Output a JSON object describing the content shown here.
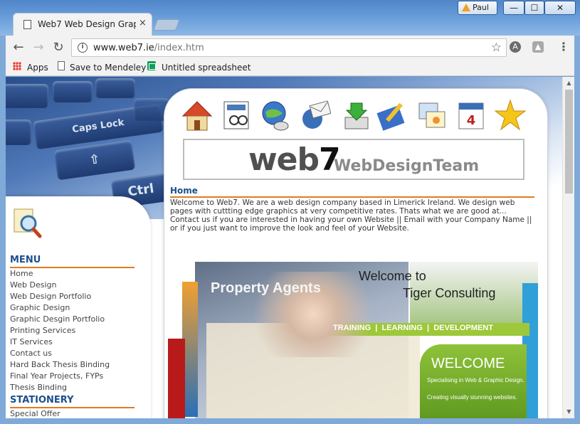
{
  "window": {
    "user_name": "Paul",
    "minimize": "—",
    "maximize": "☐",
    "close": "✕"
  },
  "tab": {
    "title": "Web7 Web Design Grap",
    "close": "×"
  },
  "toolbar": {
    "url_host": "www.web7.ie",
    "url_path": "/index.htm",
    "back": "←",
    "forward": "→",
    "reload": "↻",
    "star": "☆",
    "menu": "⋮"
  },
  "bookmarks": [
    {
      "label": "Apps",
      "icon": "apps-icon"
    },
    {
      "label": "Save to Mendeley",
      "icon": "page-icon"
    },
    {
      "label": "Untitled spreadsheet",
      "icon": "sheets-icon"
    }
  ],
  "keyboard": {
    "caps": "Caps Lock",
    "ctrl": "Ctrl"
  },
  "logo": {
    "web": "web",
    "seven": "7",
    "team": "WebDesignTeam"
  },
  "page": {
    "heading": "Home",
    "intro": "Welcome to Web7. We are a web design company based in Limerick Ireland. We design web pages with cuttting edge graphics at very competitive rates. Thats what we are good at... Contact us if you are interested in having your own Website || Email with your Company Name || or if you just want to improve the look and feel of your Website."
  },
  "sidebar": {
    "menu_heading": "MENU",
    "menu_items": [
      "Home",
      "Web Design",
      "Web Design Portfolio",
      "Graphic Design",
      "Graphic Desgin Portfolio",
      "Printing Services",
      "IT Services",
      "Contact us",
      "Hard Back Thesis Binding",
      "Final Year Projects, FYPs",
      "Thesis Binding"
    ],
    "stationery_heading": "STATIONERY",
    "stationery_items": [
      "Special Offer"
    ]
  },
  "collage": {
    "property_agents": "Property Agents",
    "welcome_to": "Welcome to",
    "tiger": "Tiger Consulting",
    "tld": "TRAINING  |  LEARNING  |  DEVELOPMENT",
    "welcome": "WELCOME",
    "specialising": "Specialising in Web & Graphic Design.",
    "creating": "Creating visually stunning websites."
  }
}
